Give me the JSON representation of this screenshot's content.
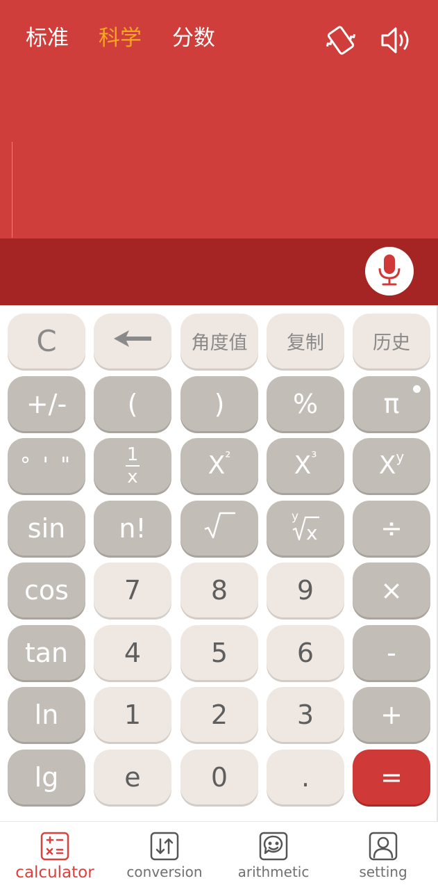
{
  "header": {
    "tabs": [
      {
        "label": "标准",
        "active": false
      },
      {
        "label": "科学",
        "active": true
      },
      {
        "label": "分数",
        "active": false
      }
    ],
    "icons": [
      "vibrate-icon",
      "speaker-icon"
    ]
  },
  "display": {
    "expression": "",
    "result": ""
  },
  "voice": {
    "icon": "microphone-icon"
  },
  "keys": {
    "clear": "C",
    "backspace_icon": "backspace-arrow-icon",
    "angle": "角度值",
    "copy": "复制",
    "history": "历史",
    "sign": "+/-",
    "lparen": "(",
    "rparen": ")",
    "percent": "%",
    "pi": "π",
    "dms": "° ' \"",
    "reciprocal_num": "1",
    "reciprocal_den": "x",
    "square_base": "X",
    "square_exp": "²",
    "cube_base": "X",
    "cube_exp": "³",
    "power_base": "X",
    "power_exp": "y",
    "sin": "sin",
    "factorial": "n!",
    "sqrt_icon": "square-root-icon",
    "yroot_icon": "y-root-icon",
    "divide": "÷",
    "cos": "cos",
    "d7": "7",
    "d8": "8",
    "d9": "9",
    "multiply": "×",
    "tan": "tan",
    "d4": "4",
    "d5": "5",
    "d6": "6",
    "minus": "-",
    "ln": "ln",
    "d1": "1",
    "d2": "2",
    "d3": "3",
    "plus": "+",
    "lg": "lg",
    "e": "e",
    "d0": "0",
    "dot": ".",
    "equals": "="
  },
  "nav": {
    "items": [
      {
        "label": "calculator",
        "icon": "calculator-icon",
        "active": true
      },
      {
        "label": "conversion",
        "icon": "conversion-icon",
        "active": false
      },
      {
        "label": "arithmetic",
        "icon": "arithmetic-icon",
        "active": false
      },
      {
        "label": "setting",
        "icon": "setting-icon",
        "active": false
      }
    ]
  },
  "colors": {
    "display_bg": "#cf3e3b",
    "result_bg": "#a52424",
    "active_tab": "#f5a623",
    "equals_key": "#cf3a38",
    "active_nav": "#d9423e"
  }
}
